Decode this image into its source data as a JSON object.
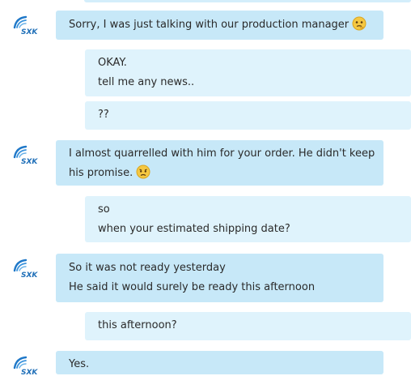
{
  "contact_logo_text": "SXK",
  "messages": [
    {
      "sender": "contact",
      "lines": [
        "Sorry, I was just talking with our production manager"
      ],
      "emoji": "thinking-face"
    },
    {
      "sender": "me",
      "lines": [
        "OKAY.",
        "tell me any news.."
      ]
    },
    {
      "sender": "me",
      "lines": [
        "??"
      ]
    },
    {
      "sender": "contact",
      "lines": [
        "I almost quarrelled with him for your order. He didn't keep",
        "his promise."
      ],
      "emoji": "worried-face"
    },
    {
      "sender": "me",
      "lines": [
        "so",
        "when your estimated shipping date?"
      ]
    },
    {
      "sender": "contact",
      "lines": [
        "So it was not ready yesterday",
        "He said it would surely be ready this afternoon"
      ]
    },
    {
      "sender": "me",
      "lines": [
        "this afternoon?"
      ]
    },
    {
      "sender": "contact",
      "lines": [
        "Yes."
      ]
    }
  ]
}
